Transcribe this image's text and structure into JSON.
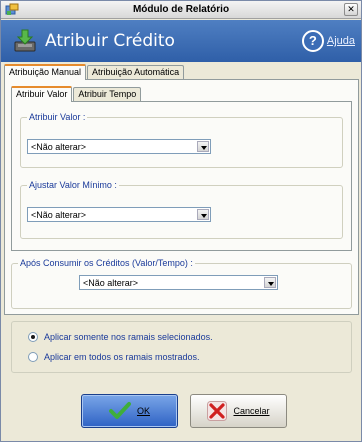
{
  "window": {
    "title": "Módulo de Relatório",
    "close_glyph": "✕"
  },
  "header": {
    "title": "Atribuir Crédito",
    "help_label": "Ajuda",
    "help_glyph": "?"
  },
  "outer_tabs": [
    {
      "label": "Atribuição Manual",
      "active": true
    },
    {
      "label": "Atribuição Automática",
      "active": false
    }
  ],
  "inner_tabs": [
    {
      "label": "Atribuir Valor",
      "active": true
    },
    {
      "label": "Atribuir Tempo",
      "active": false
    }
  ],
  "groups": {
    "atribuir_valor": {
      "legend": "Atribuir Valor :",
      "value": "<Não alterar>"
    },
    "ajustar_valor_minimo": {
      "legend": "Ajustar Valor Mínimo :",
      "value": "<Não alterar>"
    },
    "apos_consumir": {
      "legend": "Após Consumir os Créditos (Valor/Tempo) :",
      "value": "<Não alterar>"
    }
  },
  "scope_options": [
    {
      "label": "Aplicar somente nos ramais selecionados.",
      "checked": true
    },
    {
      "label": "Aplicar em todos os ramais mostrados.",
      "checked": false
    }
  ],
  "buttons": {
    "ok": "OK",
    "cancel": "Cancelar"
  },
  "colors": {
    "header_blue": "#3b6cb6",
    "tab_accent": "#e68b2c",
    "ok_button": "#2e62c4",
    "label_blue": "#1a3a9a"
  }
}
